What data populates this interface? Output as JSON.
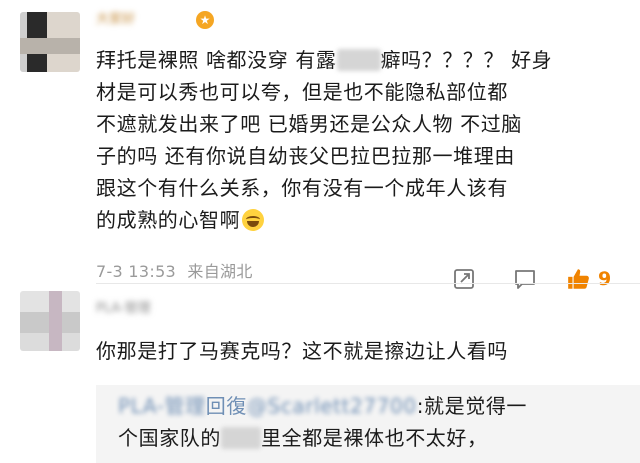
{
  "comments": [
    {
      "username": "大家好",
      "lines": [
        "拜托是裸照 啥都没穿 有露",
        "癖吗？？？？ 好身",
        "材是可以秀也可以夸，但是也不能隐私部位都",
        "不遮就发出来了吧 已婚男还是公众人物 不过脑",
        "子的吗 还有你说自幼丧父巴拉巴拉那一堆理由",
        "跟这个有什么关系，你有没有一个成年人该有",
        "的成熟的心智啊"
      ],
      "time": "7-3 13:53",
      "location": "来自湖北",
      "like_count": "9",
      "icons": {
        "share": "share-icon",
        "reply": "reply-icon",
        "like": "thumbs-up-icon"
      }
    },
    {
      "username": "PLA-管理",
      "text": "你那是打了马赛克吗？这不就是擦边让人看吗",
      "reply": {
        "author": "PLA-管理",
        "connector": "回復",
        "handle": "@Scarlett27700",
        "text_a": ":就是觉得一",
        "text_b": "个国家队的",
        "text_c": "里全都是裸体也不太好，"
      }
    }
  ],
  "colors": {
    "like_accent": "#f08300",
    "meta": "#9a9a9a",
    "link": "#6f8fb5"
  }
}
